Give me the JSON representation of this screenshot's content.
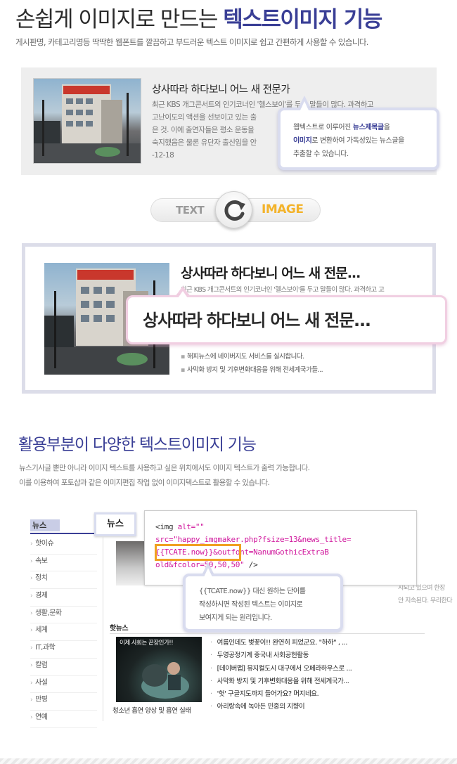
{
  "header": {
    "title_prefix": "손쉽게 이미지로 만드는",
    "title_highlight": "텍스트이미지 기능",
    "subtitle": "게시판명, 카테고리명등 딱딱한 웹폰트를 깔끔하고 부드러운 텍스트 이미지로 쉽고 간편하게 사용할 수 있습니다."
  },
  "panel1": {
    "headline": "상사따라 하다보니 어느 새 전문가",
    "body_lines": [
      "최근 KBS 개그콘서트의 인기코너인 '헬스보이'를 두고 말들이 많다. 과격하고",
      "고난이도의 액션을 선보이고 있는 출",
      "은 것. 이에 출연자들은 평소 운동을",
      "숙지했음은 물론 유단자 출신임을 안",
      "-12-18"
    ],
    "tooltip": {
      "line1_pre": "웹텍스트로 이루어진 ",
      "line1_hl": "뉴스제목글",
      "line1_post": "을",
      "line2_hl": "이미지",
      "line2_post": "로 변환하여 가독성있는 뉴스글을",
      "line3": "추출할 수 있습니다."
    }
  },
  "toggle": {
    "left_label": "TEXT",
    "right_label": "IMAGE",
    "icon": "refresh-icon"
  },
  "panel2": {
    "headline": "상사따라 하다보니 어느 새 전문...",
    "sub": "최근 KBS 개그콘서트의 인기코너인 '헬스보이'를 두고 말들이 많다. 과격하고 고",
    "list": [
      "해피뉴스에 네이버지도 서비스를 실시합니다.",
      "사막화 방지 및 기후변화대응을 위해 전세계국가들..."
    ],
    "bubble_text": "상사따라 하다보니 어느 새 전문..."
  },
  "section2": {
    "title": "활용부분이 다양한 텍스트이미지 기능",
    "desc_lines": [
      "뉴스기사글 뿐만 아니라 이미지 텍스트를 사용하고 싶은 위치에서도 이미지 텍스트가 출력 가능합니다.",
      "이를 이용하여 포토샵과 같은 이미지편집 작업 없이 이미지텍스트로 활용할 수 있습니다."
    ]
  },
  "mock": {
    "tab_label": "뉴스",
    "tab_popup_label": "뉴스",
    "sidebar_items": [
      "핫이슈",
      "속보",
      "정치",
      "경제",
      "생활,문화",
      "세계",
      "IT,과학",
      "칼럼",
      "사설",
      "만평",
      "연예"
    ],
    "code": {
      "line1_a": "<img ",
      "line1_b": "alt=\"\"",
      "line2": "src=\"happy_imgmaker.php?fsize=13&news_title=",
      "line3_a": "{{TCATE.now}}",
      "line3_b": "&outfont=NanumGothicExtraB",
      "line4_a": "old&fcolor=50,50,50\"",
      "line4_b": " />"
    },
    "right_snips": [
      "기대",
      "시되고 있으며 한장",
      "안 지속된다. 무리한다"
    ],
    "tooltip2_lines": [
      "{{TCATE.now}} 대신 원하는 단어를",
      "작성하시면 작성된 텍스트는 이미지로",
      "보여지게 되는 원리입니다."
    ],
    "hot_heading": "핫뉴스",
    "hot_photo_caption": "이제 사회는 끝장인가!!",
    "hot_photo_text": "청소년 흡연 양상 및 흡연 실태",
    "hot_list": [
      "여름인데도 벚꽃이!! 완연히 피었군요. \"하하\" , ...",
      "두영공정기계 중국내 사회공헌활동",
      "[데이버맵] 뮤지컬도시 대구에서 오페라하우스로 ...",
      "사막화 방지 및 기후변화대응을 위해 전세계국가...",
      "'헛' 구글지도까지 들어가요? 머지네요.",
      "아리랑속에 녹아든 민중의 지향이"
    ]
  }
}
